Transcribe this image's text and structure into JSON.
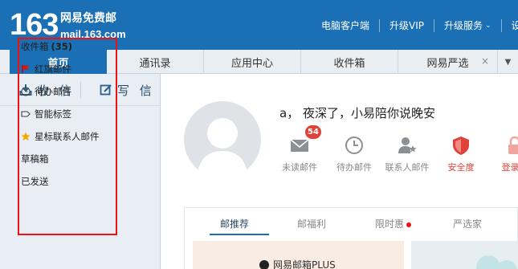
{
  "header": {
    "logo_number": "163",
    "logo_name": "网易免费邮",
    "logo_domain": "mail.163.com",
    "links": [
      "电脑客户端",
      "升级VIP",
      "升级服务",
      "设"
    ],
    "brand_color": "#1b6fb4"
  },
  "tabs": [
    {
      "label": "首页",
      "active": true
    },
    {
      "label": "通讯录",
      "active": false
    },
    {
      "label": "应用中心",
      "active": false
    },
    {
      "label": "收件箱",
      "active": false
    },
    {
      "label": "网易严选",
      "active": false,
      "closable": true,
      "close": "×"
    }
  ],
  "sidebar": {
    "receive_label": "收 信",
    "compose_label": "写 信",
    "inbox_label": "收件箱",
    "inbox_count": "(35)",
    "items": [
      {
        "label": "红旗邮件",
        "icon": "red-flag-icon"
      },
      {
        "label": "待办邮件",
        "icon": "clock-icon"
      },
      {
        "label": "智能标签",
        "icon": "tag-icon"
      },
      {
        "label": "星标联系人邮件",
        "icon": "star-icon"
      },
      {
        "label": "草稿箱",
        "icon": ""
      },
      {
        "label": "已发送",
        "icon": ""
      }
    ]
  },
  "main": {
    "greeting": "a， 夜深了，小易陪你说晚安",
    "unread_badge": "54",
    "stats": [
      {
        "label": "未读邮件",
        "icon": "envelope-icon"
      },
      {
        "label": "待办邮件",
        "icon": "clock-icon"
      },
      {
        "label": "联系人邮件",
        "icon": "contact-star-icon"
      },
      {
        "label": "安全度",
        "icon": "shield-icon"
      },
      {
        "label": "登录保",
        "icon": "lock-icon"
      }
    ],
    "subtabs": [
      "邮推荐",
      "邮福利",
      "限时惠",
      "严选家"
    ],
    "banner_text": "网易邮箱PLUS"
  }
}
